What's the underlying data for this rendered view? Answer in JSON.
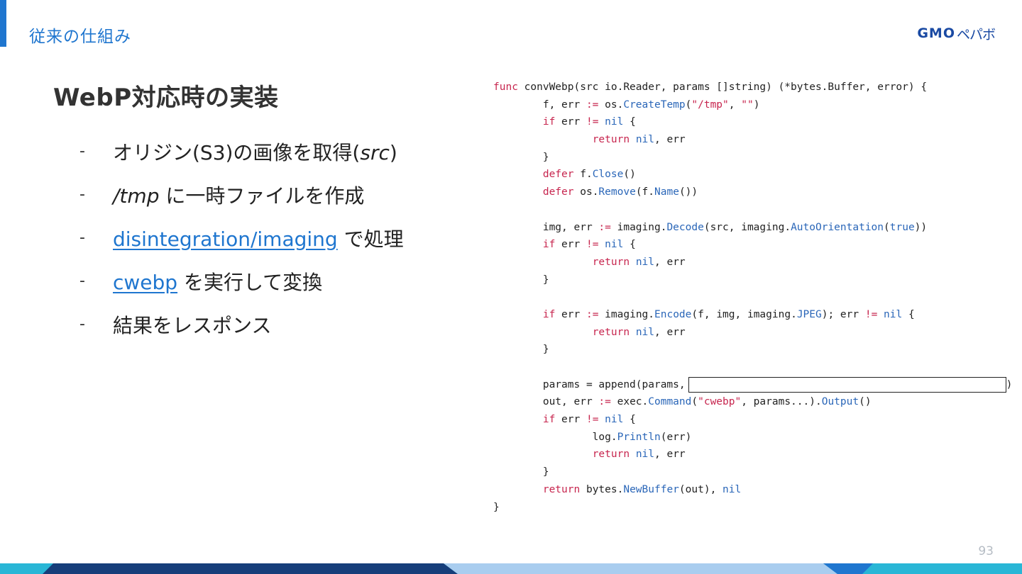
{
  "section_title": "従来の仕組み",
  "logo": {
    "text": "GMO",
    "kana": "ペパボ"
  },
  "heading": "WebP対応時の実装",
  "bullets": [
    {
      "dash": "-",
      "pre": "オリジン(S3)の画像を取得(",
      "em": "src",
      "post": ")"
    },
    {
      "dash": "-",
      "em": "/tmp",
      "post": " に一時ファイルを作成"
    },
    {
      "dash": "-",
      "link": "disintegration/imaging",
      "post": " で処理"
    },
    {
      "dash": "-",
      "link": "cwebp",
      "post": " を実行して変換"
    },
    {
      "dash": "-",
      "post": "結果をレスポンス"
    }
  ],
  "page_number": "93",
  "colors": {
    "accent": "#1f76cf",
    "logo": "#1a4aa3",
    "keyword": "#c7254e",
    "function": "#2a66b8"
  }
}
